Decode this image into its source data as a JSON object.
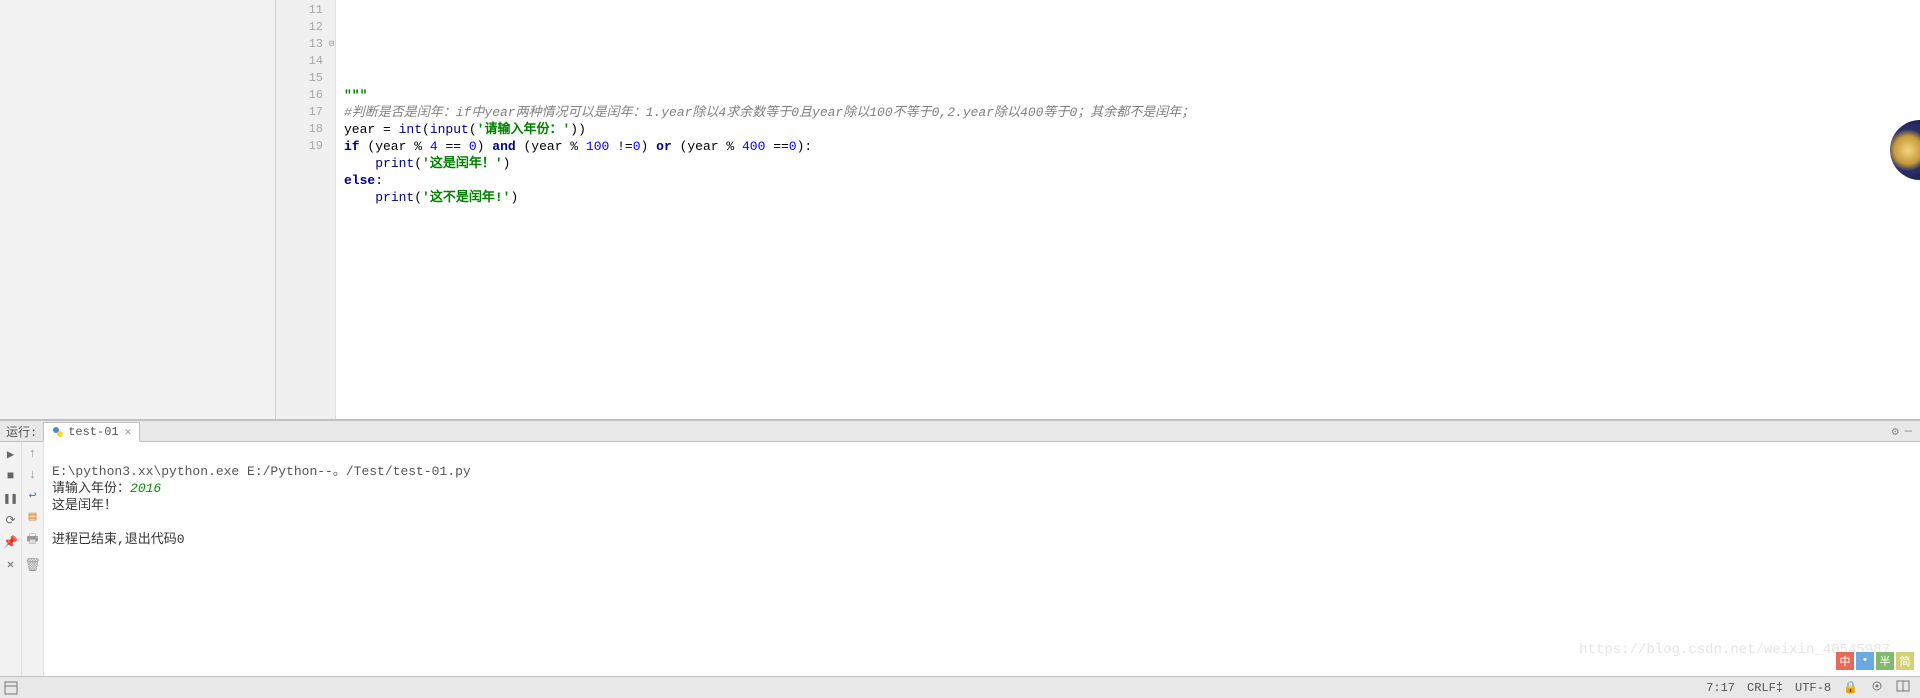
{
  "editor": {
    "line_start": 11,
    "lines": [
      {
        "n": 11,
        "tokens": []
      },
      {
        "n": 12,
        "tokens": []
      },
      {
        "n": 13,
        "tokens": [
          {
            "t": "\"\"\"",
            "c": "str"
          }
        ]
      },
      {
        "n": 14,
        "tokens": [
          {
            "t": "#判断是否是闰年：if中year两种情况可以是闰年：1.year除以4求余数等于0且year除以100不等于0,2.year除以400等于0；其余都不是闰年；",
            "c": "comment"
          }
        ]
      },
      {
        "n": 15,
        "tokens": [
          {
            "t": "year = "
          },
          {
            "t": "int",
            "c": "builtin"
          },
          {
            "t": "("
          },
          {
            "t": "input",
            "c": "builtin"
          },
          {
            "t": "("
          },
          {
            "t": "'请输入年份：'",
            "c": "str"
          },
          {
            "t": "))"
          }
        ]
      },
      {
        "n": 16,
        "tokens": [
          {
            "t": "if ",
            "c": "kw"
          },
          {
            "t": "(year % "
          },
          {
            "t": "4",
            "c": "num"
          },
          {
            "t": " == "
          },
          {
            "t": "0",
            "c": "num"
          },
          {
            "t": ") "
          },
          {
            "t": "and ",
            "c": "kw"
          },
          {
            "t": "(year % "
          },
          {
            "t": "100",
            "c": "num"
          },
          {
            "t": " !="
          },
          {
            "t": "0",
            "c": "num"
          },
          {
            "t": ") "
          },
          {
            "t": "or ",
            "c": "kw"
          },
          {
            "t": "(year % "
          },
          {
            "t": "400",
            "c": "num"
          },
          {
            "t": " =="
          },
          {
            "t": "0",
            "c": "num"
          },
          {
            "t": "):"
          }
        ]
      },
      {
        "n": 17,
        "tokens": [
          {
            "t": "    "
          },
          {
            "t": "print",
            "c": "builtin"
          },
          {
            "t": "("
          },
          {
            "t": "'这是闰年！'",
            "c": "str"
          },
          {
            "t": ")"
          }
        ]
      },
      {
        "n": 18,
        "tokens": [
          {
            "t": "else",
            "c": "kw"
          },
          {
            "t": ":"
          }
        ]
      },
      {
        "n": 19,
        "tokens": [
          {
            "t": "    "
          },
          {
            "t": "print",
            "c": "builtin"
          },
          {
            "t": "("
          },
          {
            "t": "'这不是闰年!'",
            "c": "str"
          },
          {
            "t": ")"
          }
        ]
      }
    ]
  },
  "run_panel": {
    "label": "运行:",
    "tab_name": "test-01",
    "console": {
      "cmd": "E:\\python3.xx\\python.exe E:/Python--。/Test/test-01.py",
      "prompt": "请输入年份：",
      "input": "2016",
      "output": "这是闰年！",
      "exit_msg": "进程已结束,退出代码0"
    }
  },
  "status": {
    "cursor": "7:17",
    "line_sep": "CRLF",
    "encoding": "UTF-8"
  },
  "watermark": "https://blog.csdn.net/weixin_40545987",
  "badges": [
    {
      "t": "中",
      "bg": "#e66a5a"
    },
    {
      "t": "•",
      "bg": "#6aa8e6"
    },
    {
      "t": "半",
      "bg": "#7fba6e"
    },
    {
      "t": "简",
      "bg": "#d4d07a"
    }
  ],
  "icons": {
    "play": "▶",
    "up": "↑",
    "down": "↓",
    "pause": "❚❚",
    "stop": "■",
    "restart": "⟳",
    "pin": "📌",
    "close": "✕",
    "gear": "⚙",
    "minimize": "—",
    "layout": "▤",
    "wrap": "↩",
    "print": "🖶",
    "trash": "🗑",
    "lock": "🔒",
    "inspector": "👁",
    "split": "◫"
  }
}
